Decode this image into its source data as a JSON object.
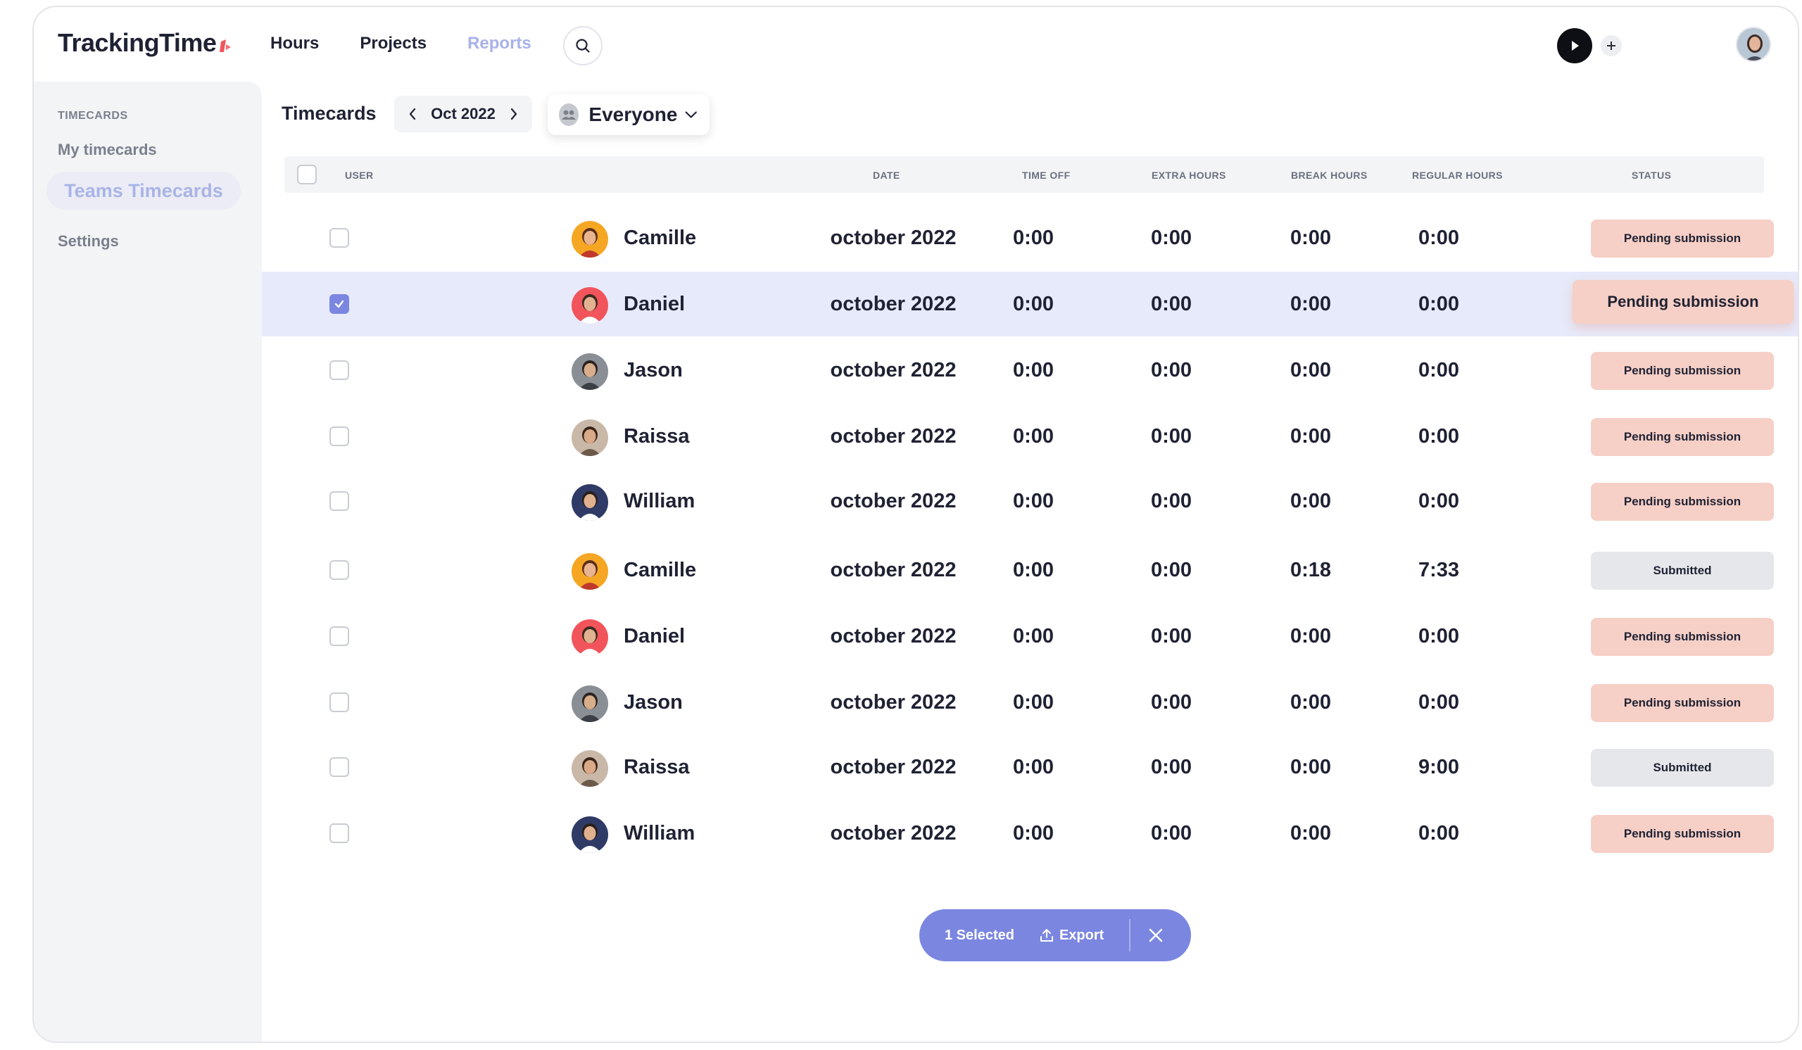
{
  "app": {
    "logo": "TrackingTime",
    "brand_color": "#f2545b",
    "accent_color": "#7b86e0"
  },
  "nav": {
    "hours": "Hours",
    "projects": "Projects",
    "reports": "Reports"
  },
  "sidebar": {
    "section": "TIMECARDS",
    "items": [
      {
        "label": "My timecards"
      },
      {
        "label": "Teams Timecards",
        "active": true
      },
      {
        "label": "Settings"
      }
    ]
  },
  "header": {
    "title": "Timecards",
    "month": "Oct 2022",
    "people_filter": "Everyone"
  },
  "table": {
    "columns": {
      "user": "USER",
      "date": "DATE",
      "time_off": "TIME OFF",
      "extra_hours": "EXTRA HOURS",
      "break_hours": "BREAK HOURS",
      "regular_hours": "REGULAR HOURS",
      "status": "STATUS"
    },
    "rows": [
      {
        "name": "Camille",
        "date": "october 2022",
        "time_off": "0:00",
        "extra": "0:00",
        "break": "0:00",
        "regular": "0:00",
        "status": "Pending submission",
        "status_type": "pending",
        "checked": false
      },
      {
        "name": "Daniel",
        "date": "october 2022",
        "time_off": "0:00",
        "extra": "0:00",
        "break": "0:00",
        "regular": "0:00",
        "status": "Pending submission",
        "status_type": "pending",
        "checked": true
      },
      {
        "name": "Jason",
        "date": "october 2022",
        "time_off": "0:00",
        "extra": "0:00",
        "break": "0:00",
        "regular": "0:00",
        "status": "Pending submission",
        "status_type": "pending",
        "checked": false
      },
      {
        "name": "Raissa",
        "date": "october 2022",
        "time_off": "0:00",
        "extra": "0:00",
        "break": "0:00",
        "regular": "0:00",
        "status": "Pending submission",
        "status_type": "pending",
        "checked": false
      },
      {
        "name": "William",
        "date": "october 2022",
        "time_off": "0:00",
        "extra": "0:00",
        "break": "0:00",
        "regular": "0:00",
        "status": "Pending submission",
        "status_type": "pending",
        "checked": false
      },
      {
        "name": "Camille",
        "date": "october 2022",
        "time_off": "0:00",
        "extra": "0:00",
        "break": "0:18",
        "regular": "7:33",
        "status": "Submitted",
        "status_type": "submitted",
        "checked": false
      },
      {
        "name": "Daniel",
        "date": "october 2022",
        "time_off": "0:00",
        "extra": "0:00",
        "break": "0:00",
        "regular": "0:00",
        "status": "Pending submission",
        "status_type": "pending",
        "checked": false
      },
      {
        "name": "Jason",
        "date": "october 2022",
        "time_off": "0:00",
        "extra": "0:00",
        "break": "0:00",
        "regular": "0:00",
        "status": "Pending submission",
        "status_type": "pending",
        "checked": false
      },
      {
        "name": "Raissa",
        "date": "october 2022",
        "time_off": "0:00",
        "extra": "0:00",
        "break": "0:00",
        "regular": "9:00",
        "status": "Submitted",
        "status_type": "submitted",
        "checked": false
      },
      {
        "name": "William",
        "date": "october 2022",
        "time_off": "0:00",
        "extra": "0:00",
        "break": "0:00",
        "regular": "0:00",
        "status": "Pending submission",
        "status_type": "pending",
        "checked": false
      }
    ]
  },
  "action_bar": {
    "selected": "1 Selected",
    "export": "Export"
  }
}
